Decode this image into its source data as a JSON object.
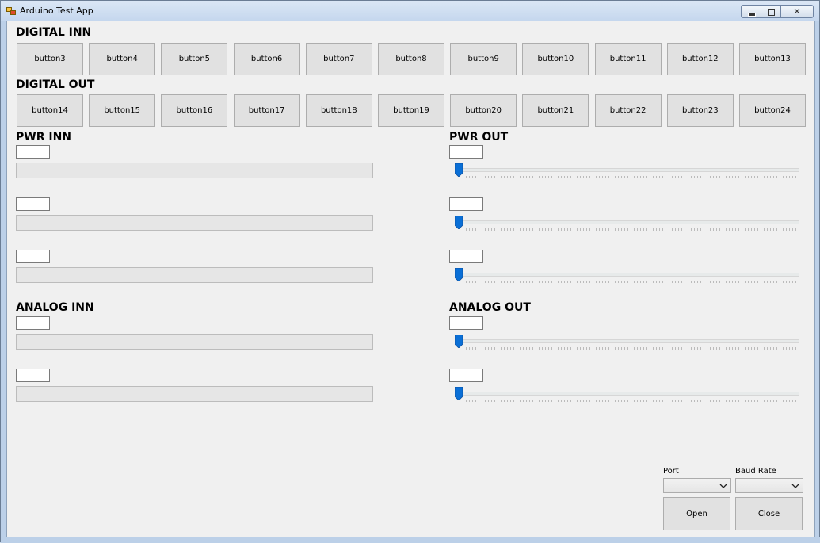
{
  "window": {
    "title": "Arduino Test App",
    "close_symbol": "✕"
  },
  "digital_in": {
    "label": "DIGITAL INN",
    "buttons": [
      "button3",
      "button4",
      "button5",
      "button6",
      "button7",
      "button8",
      "button9",
      "button10",
      "button11",
      "button12",
      "button13"
    ]
  },
  "digital_out": {
    "label": "DIGITAL OUT",
    "buttons": [
      "button14",
      "button15",
      "button16",
      "button17",
      "button18",
      "button19",
      "button20",
      "button21",
      "button22",
      "button23",
      "button24"
    ]
  },
  "pwr_in": {
    "label": "PWR INN",
    "channels": [
      {
        "value": "",
        "progress": 0
      },
      {
        "value": "",
        "progress": 0
      },
      {
        "value": "",
        "progress": 0
      }
    ]
  },
  "pwr_out": {
    "label": "PWR OUT",
    "channels": [
      {
        "value": "",
        "slider": 0
      },
      {
        "value": "",
        "slider": 0
      },
      {
        "value": "",
        "slider": 0
      }
    ]
  },
  "analog_in": {
    "label": "ANALOG INN",
    "channels": [
      {
        "value": "",
        "progress": 0
      },
      {
        "value": "",
        "progress": 0
      }
    ]
  },
  "analog_out": {
    "label": "ANALOG OUT",
    "channels": [
      {
        "value": "",
        "slider": 0
      },
      {
        "value": "",
        "slider": 0
      }
    ]
  },
  "serial": {
    "port_label": "Port",
    "port_value": "",
    "baud_label": "Baud Rate",
    "baud_value": "",
    "open_label": "Open",
    "close_label": "Close"
  },
  "colors": {
    "accent": "#0a6fd6",
    "progress_fill": "#06b025"
  }
}
